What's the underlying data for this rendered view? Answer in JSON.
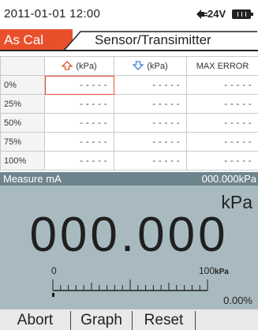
{
  "status": {
    "datetime": "2011-01-01 12:00",
    "voltage": "24V",
    "plug_icon": "plug-icon",
    "battery_icon": "battery-icon"
  },
  "tabs": {
    "active": "As Cal",
    "inactive": "Sensor/Transimitter"
  },
  "table": {
    "headers": [
      "",
      "(kPa)",
      "(kPa)",
      "MAX ERROR"
    ],
    "header_icons": [
      "",
      "up-arrow-icon",
      "down-arrow-icon",
      ""
    ],
    "rows": [
      {
        "label": "0%",
        "up": "-----",
        "down": "-----",
        "err": "-----"
      },
      {
        "label": "25%",
        "up": "-----",
        "down": "-----",
        "err": "-----"
      },
      {
        "label": "50%",
        "up": "-----",
        "down": "-----",
        "err": "-----"
      },
      {
        "label": "75%",
        "up": "-----",
        "down": "-----",
        "err": "-----"
      },
      {
        "label": "100%",
        "up": "-----",
        "down": "-----",
        "err": "-----"
      }
    ]
  },
  "measure": {
    "label": "Measure mA",
    "value": "000.000kPa"
  },
  "display": {
    "unit": "kPa",
    "value": "000.000",
    "scale_min": "0",
    "scale_max": "100",
    "scale_unit": "kPa",
    "percent": "0.00%",
    "level_fraction": 0
  },
  "buttons": [
    "Abort",
    "Graph",
    "Reset"
  ],
  "colors": {
    "accent": "#e8502c",
    "blue": "#3a84d0",
    "panel": "#a8bac0",
    "measure_bar": "#6e858d"
  }
}
